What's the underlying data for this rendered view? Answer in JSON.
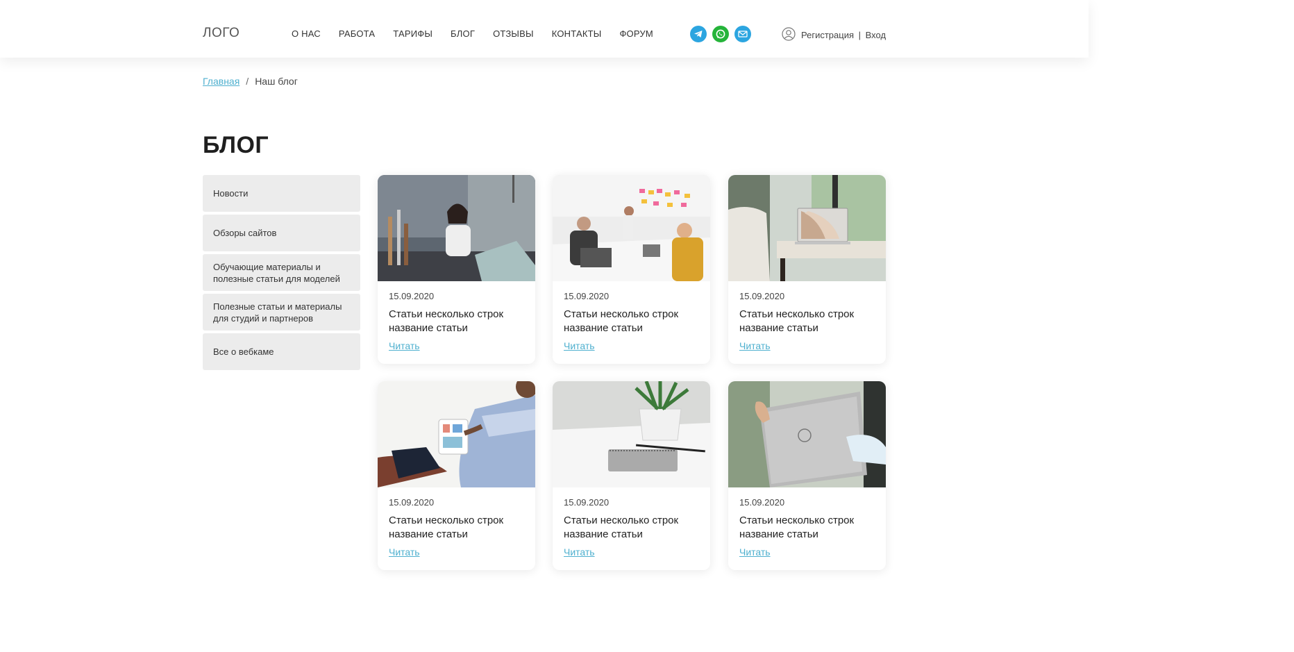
{
  "header": {
    "logo": "ЛОГО",
    "nav": [
      "О НАС",
      "РАБОТА",
      "ТАРИФЫ",
      "БЛОГ",
      "ОТЗЫВЫ",
      "КОНТАКТЫ",
      "ФОРУМ"
    ],
    "socials": [
      "telegram-icon",
      "whatsapp-icon",
      "mail-icon"
    ],
    "auth": {
      "register": "Регистрация",
      "separator": "|",
      "login": "Вход"
    }
  },
  "breadcrumb": {
    "home": "Главная",
    "separator": "/",
    "current": "Наш блог"
  },
  "page_title": "БЛОГ",
  "sidebar": {
    "items": [
      "Новости",
      "Обзоры сайтов",
      "Обучающие материалы и полезные статьи для моделей",
      "Полезные статьи и материалы для студий и партнеров",
      "Все о вебкаме"
    ]
  },
  "cards": [
    {
      "date": "15.09.2020",
      "title": "Статьи несколько строк название статьи",
      "read": "Читать"
    },
    {
      "date": "15.09.2020",
      "title": "Статьи несколько строк название статьи",
      "read": "Читать"
    },
    {
      "date": "15.09.2020",
      "title": "Статьи несколько строк название статьи",
      "read": "Читать"
    },
    {
      "date": "15.09.2020",
      "title": "Статьи несколько строк название статьи",
      "read": "Читать"
    },
    {
      "date": "15.09.2020",
      "title": "Статьи несколько строк название статьи",
      "read": "Читать"
    },
    {
      "date": "15.09.2020",
      "title": "Статьи несколько строк название статьи",
      "read": "Читать"
    }
  ],
  "colors": {
    "accent": "#4fb0cf",
    "sidebar_bg": "#ececec",
    "telegram": "#2ca5e0",
    "whatsapp": "#25b43a"
  }
}
